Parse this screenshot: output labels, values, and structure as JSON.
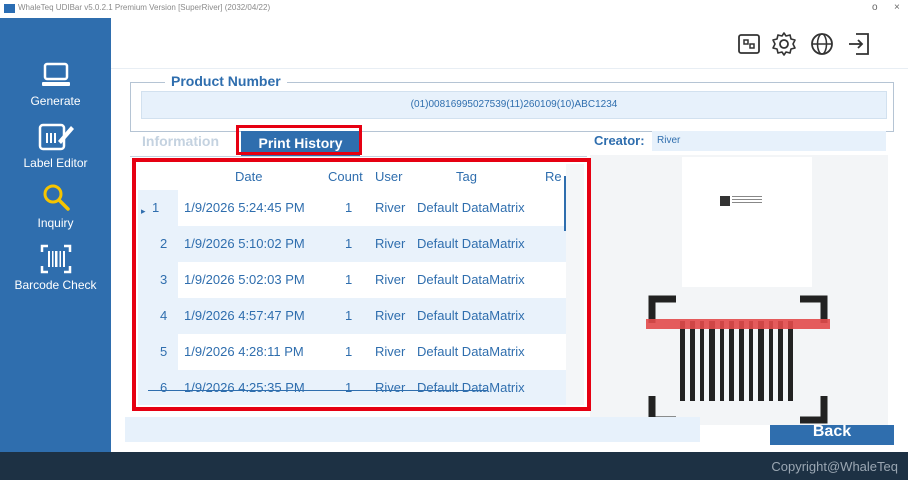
{
  "window": {
    "title": "WhaleTeq UDIBar v5.0.2.1   Premium Version   [SuperRiver] (2032/04/22)",
    "minimize": "o",
    "close": "×"
  },
  "sidebar": {
    "items": [
      {
        "label": "Generate",
        "icon": "laptop-icon"
      },
      {
        "label": "Label Editor",
        "icon": "label-edit-icon"
      },
      {
        "label": "Inquiry",
        "icon": "search-icon"
      },
      {
        "label": "Barcode Check",
        "icon": "barcode-scan-icon"
      }
    ]
  },
  "topbar": {
    "icons": [
      "label-preview-icon",
      "gear-icon",
      "globe-icon",
      "logout-icon"
    ]
  },
  "product_number": {
    "label": "Product Number",
    "value": "(01)00816995027539(11)260109(10)ABC1234"
  },
  "tabs": [
    {
      "label": "Information",
      "active": false
    },
    {
      "label": "Print History",
      "active": true
    }
  ],
  "creator": {
    "label": "Creator:",
    "value": "River"
  },
  "history_table": {
    "columns": [
      "Date",
      "Count",
      "User",
      "Tag",
      "Re"
    ],
    "rows": [
      {
        "index": "1",
        "date": "1/9/2026 5:24:45 PM",
        "count": "1",
        "user": "River",
        "tag": "Default DataMatrix",
        "current": true
      },
      {
        "index": "2",
        "date": "1/9/2026 5:10:02 PM",
        "count": "1",
        "user": "River",
        "tag": "Default DataMatrix",
        "current": false
      },
      {
        "index": "3",
        "date": "1/9/2026 5:02:03 PM",
        "count": "1",
        "user": "River",
        "tag": "Default DataMatrix",
        "current": false
      },
      {
        "index": "4",
        "date": "1/9/2026 4:57:47 PM",
        "count": "1",
        "user": "River",
        "tag": "Default DataMatrix",
        "current": false
      },
      {
        "index": "5",
        "date": "1/9/2026 4:28:11 PM",
        "count": "1",
        "user": "River",
        "tag": "Default DataMatrix",
        "current": false
      },
      {
        "index": "6",
        "date": "1/9/2026 4:25:35 PM",
        "count": "1",
        "user": "River",
        "tag": "Default DataMatrix",
        "current": false
      }
    ],
    "current_row_marker": "▸"
  },
  "back_button": {
    "label": "Back"
  },
  "footer": {
    "copyright": "Copyright@WhaleTeq"
  },
  "colors": {
    "primary": "#2f6eae",
    "highlight": "#e60012",
    "footer_bg": "#1d3144",
    "field_bg": "#e7f1fb"
  }
}
